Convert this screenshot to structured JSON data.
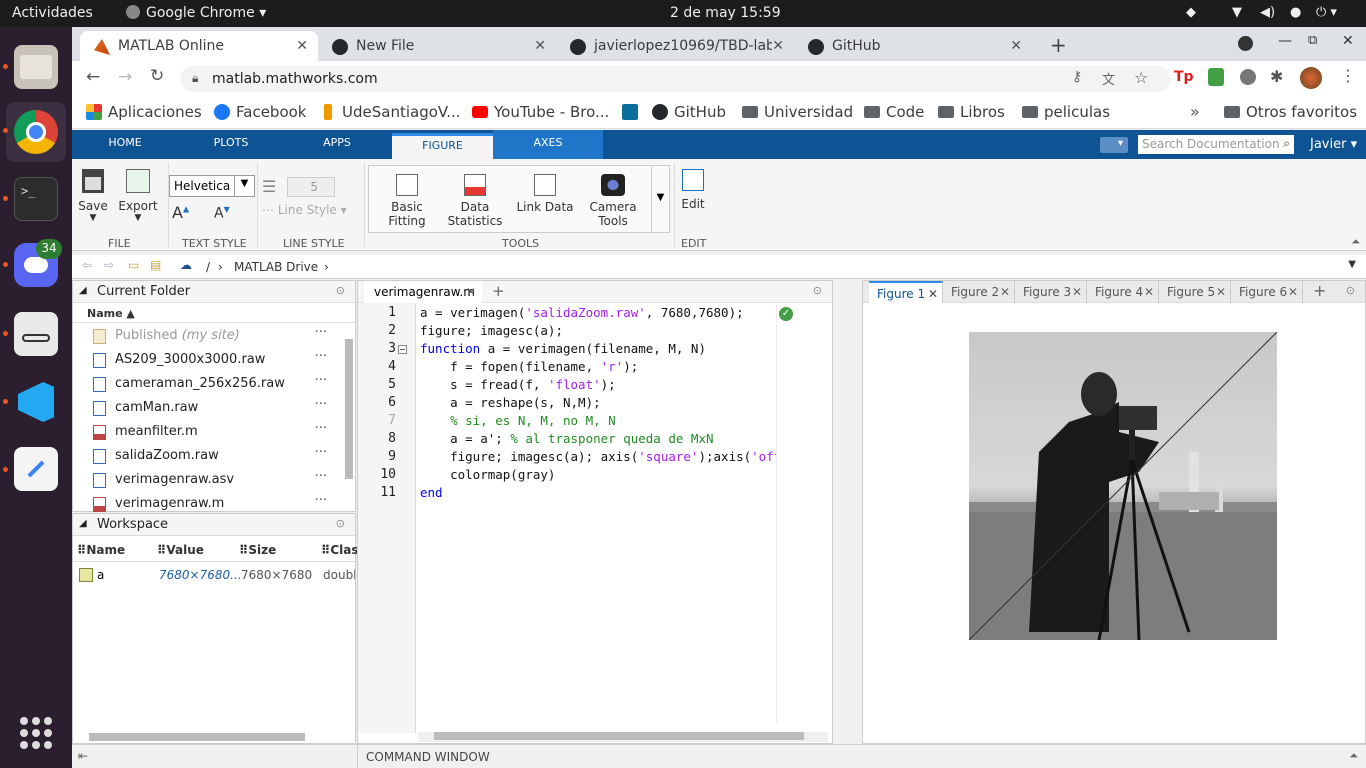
{
  "gnome": {
    "activities": "Actividades",
    "app": "Google Chrome",
    "clock": "2 de may  15:59"
  },
  "dock": {
    "discord_badge": "34"
  },
  "chrome": {
    "tabs": [
      {
        "label": "MATLAB Online"
      },
      {
        "label": "New File"
      },
      {
        "label": "javierlopez10969/TBD-lab"
      },
      {
        "label": "GitHub"
      }
    ],
    "url": "matlab.mathworks.com",
    "bookmarks": [
      "Aplicaciones",
      "Facebook",
      "UdeSantiagoV...",
      "YouTube - Bro...",
      "GitHub",
      "Universidad",
      "Code",
      "Libros",
      "peliculas"
    ],
    "other_bookmarks": "Otros favoritos"
  },
  "matlab": {
    "tabs": [
      "HOME",
      "PLOTS",
      "APPS",
      "FIGURE",
      "AXES"
    ],
    "search_placeholder": "Search Documentation",
    "user": "Javier",
    "ribbon": {
      "save": "Save",
      "export": "Export",
      "font": "Helvetica",
      "line_width": "5",
      "line_style": "Line Style",
      "basic_fitting": [
        "Basic",
        "Fitting"
      ],
      "data_statistics": [
        "Data",
        "Statistics"
      ],
      "link_data": "Link Data",
      "camera_tools": [
        "Camera",
        "Tools"
      ],
      "edit": "Edit",
      "groups": [
        "FILE",
        "TEXT STYLE",
        "LINE STYLE",
        "TOOLS",
        "EDIT"
      ]
    },
    "address": {
      "sep": "/",
      "drive": "MATLAB Drive"
    },
    "current_folder": {
      "title": "Current Folder",
      "name_col": "Name",
      "published": "Published",
      "published_hint": "(my site)",
      "files": [
        "AS209_3000x3000.raw",
        "cameraman_256x256.raw",
        "camMan.raw",
        "meanfilter.m",
        "salidaZoom.raw",
        "verimagenraw.asv",
        "verimagenraw.m"
      ]
    },
    "workspace": {
      "title": "Workspace",
      "cols": [
        "Name",
        "Value",
        "Size",
        "Clas"
      ],
      "row": {
        "name": "a",
        "value": "7680×7680...",
        "size": "7680×7680",
        "class": "double"
      }
    },
    "editor": {
      "tab": "verimagenraw.m",
      "line_numbers": [
        "1",
        "2",
        "3",
        "4",
        "5",
        "6",
        "7",
        "8",
        "9",
        "10",
        "11"
      ]
    },
    "figures": [
      "Figure 1",
      "Figure 2",
      "Figure 3",
      "Figure 4",
      "Figure 5",
      "Figure 6"
    ],
    "command_window": "COMMAND WINDOW"
  }
}
